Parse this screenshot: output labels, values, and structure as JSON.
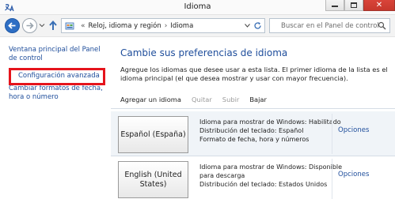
{
  "window": {
    "title": "Idioma"
  },
  "address": {
    "prefix": "«",
    "crumbs": [
      "Reloj, idioma y región",
      "Idioma"
    ],
    "separator": "›"
  },
  "search": {
    "placeholder": "Buscar en el Panel de control"
  },
  "sidebar": {
    "items": [
      {
        "label": "Ventana principal del Panel de control"
      },
      {
        "label": "Configuración avanzada"
      },
      {
        "label": "Cambiar formatos de fecha, hora o número"
      }
    ]
  },
  "main": {
    "heading": "Cambie sus preferencias de idioma",
    "description": "Agregue los idiomas que desee usar a esta lista. El primer idioma de la lista es el idioma principal (el que desea mostrar y usar con mayor frecuencia).",
    "toolbar": {
      "add": "Agregar un idioma",
      "remove": "Quitar",
      "up": "Subir",
      "down": "Bajar"
    },
    "languages": [
      {
        "name": "Español (España)",
        "details": [
          "Idioma para mostrar de Windows: Habilitado",
          "Distribución del teclado: Español",
          "Formato de fecha, hora y números"
        ],
        "options": "Opciones"
      },
      {
        "name": "English (United States)",
        "details": [
          "Idioma para mostrar de Windows: Disponible",
          "para descarga",
          "Distribución del teclado: Estados Unidos"
        ],
        "options": "Opciones"
      }
    ]
  },
  "colors": {
    "link": "#1e4d9b",
    "highlight": "#e5141c",
    "back_button": "#2e6ec4"
  }
}
